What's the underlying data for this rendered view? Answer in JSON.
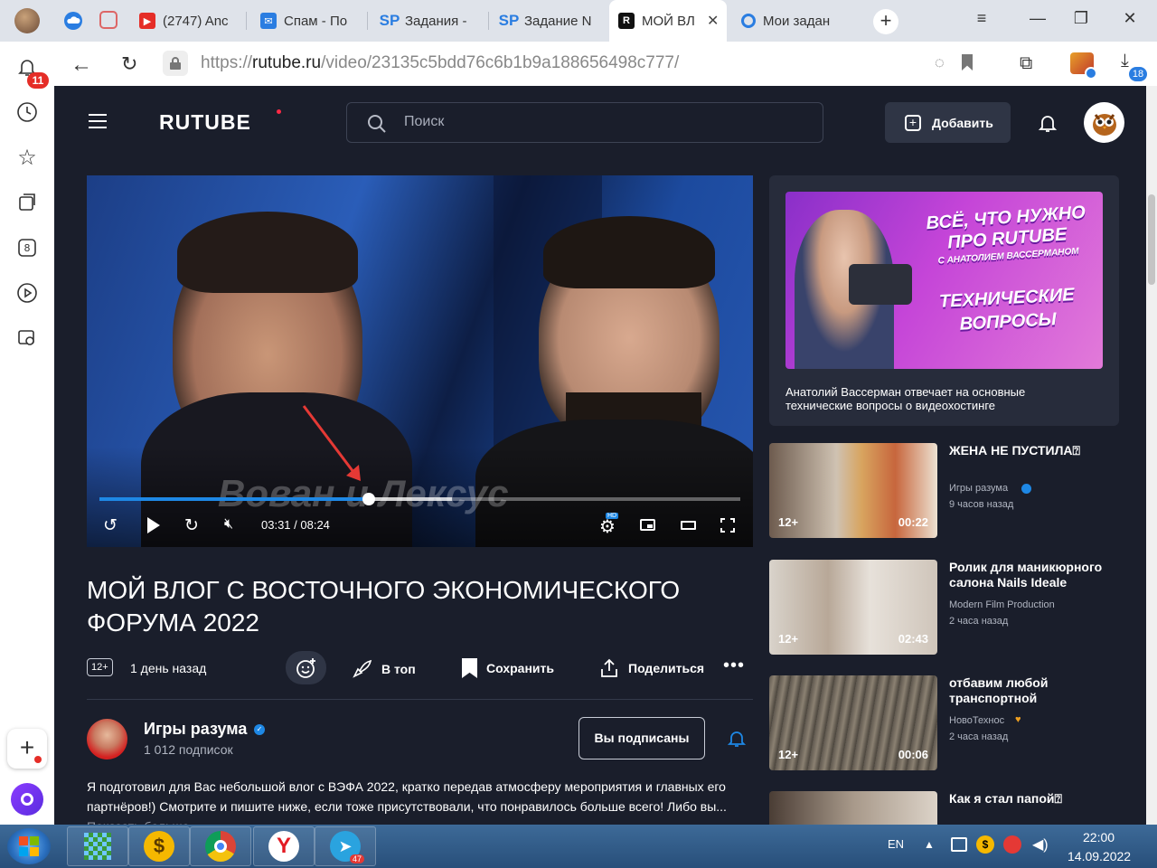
{
  "browser": {
    "tabs": [
      {
        "label": "(2747) Anc",
        "icon": "youtube-icon",
        "color": "#e52d27"
      },
      {
        "label": "Спам - По",
        "icon": "mail-icon",
        "color": "#2a7de1"
      },
      {
        "label": "Задания -",
        "icon": "sp-icon",
        "color": "#2a7de1"
      },
      {
        "label": "Задание N",
        "icon": "sp-icon",
        "color": "#2a7de1"
      },
      {
        "label": "МОЙ ВЛ",
        "icon": "rutube-icon",
        "color": "#111"
      },
      {
        "label": "Мои задан",
        "icon": "target-icon",
        "color": "#2a7de1"
      }
    ],
    "url_prefix": "https://",
    "url_domain": "rutube.ru",
    "url_path": "/video/23135c5bdd76c6b1b9a188656498c777/",
    "notif_count": "11",
    "download_count": "18"
  },
  "header": {
    "logo": "RUTUBE",
    "search_placeholder": "Поиск",
    "add_label": "Добавить"
  },
  "player": {
    "time": "03:31 / 08:24",
    "progress": 0.42,
    "buffered": 0.55,
    "watermark": "Вован и Лексус",
    "hd_badge": "HD"
  },
  "video": {
    "title_line1": "МОЙ ВЛОГ С ВОСТОЧНОГО ЭКОНОМИЧЕСКОГО",
    "title_line2": "ФОРУМА 2022",
    "age": "12+",
    "date": "1 день назад",
    "top_label": "В топ",
    "save_label": "Сохранить",
    "share_label": "Поделиться"
  },
  "channel": {
    "name": "Игры разума",
    "subs": "1 012 подписок",
    "subscribed_label": "Вы подписаны",
    "desc1": "Я подготовил для Вас небольшой влог с ВЭФА 2022, кратко передав атмосферу мероприятия и главных его",
    "desc2": "партнёров!) Смотрите и пишите ниже, если тоже присутствовали, что понравилось больше всего! Либо вы...",
    "more": "Показать больше"
  },
  "promo": {
    "line1": "ВСЁ, ЧТО НУЖНО",
    "line2": "ПРО RUTUBE",
    "line3": "С АНАТОЛИЕМ ВАССЕРМАНОМ",
    "line4": "ТЕХНИЧЕСКИЕ",
    "line5": "ВОПРОСЫ",
    "caption1": "Анатолий Вассерман отвечает на основные",
    "caption2": "технические вопросы о видеохостинге"
  },
  "recommendations": [
    {
      "title1": "ЖЕНА НЕ ПУСТИЛА⍰",
      "title2": "",
      "channel": "Игры разума",
      "time": "9 часов назад",
      "age": "12+",
      "duration": "00:22"
    },
    {
      "title1": "Ролик для маникюрного",
      "title2": "салона Nails Ideale",
      "channel": "Modern Film Production",
      "time": "2 часа назад",
      "age": "12+",
      "duration": "02:43"
    },
    {
      "title1": "отбавим любой",
      "title2": "транспортной",
      "channel": "НовоТехнос",
      "time": "2 часа назад",
      "age": "12+",
      "duration": "00:06"
    },
    {
      "title1": "Как я стал папой⍰",
      "title2": "",
      "channel": "",
      "time": "",
      "age": "",
      "duration": ""
    }
  ],
  "taskbar": {
    "lang": "EN",
    "time": "22:00",
    "date": "14.09.2022",
    "telegram_count": "47"
  },
  "colors": {
    "accent": "#1e88e5",
    "page_bg": "#1a1e2b",
    "card_bg": "#272c3b",
    "logo_dot": "#ff2a45"
  }
}
